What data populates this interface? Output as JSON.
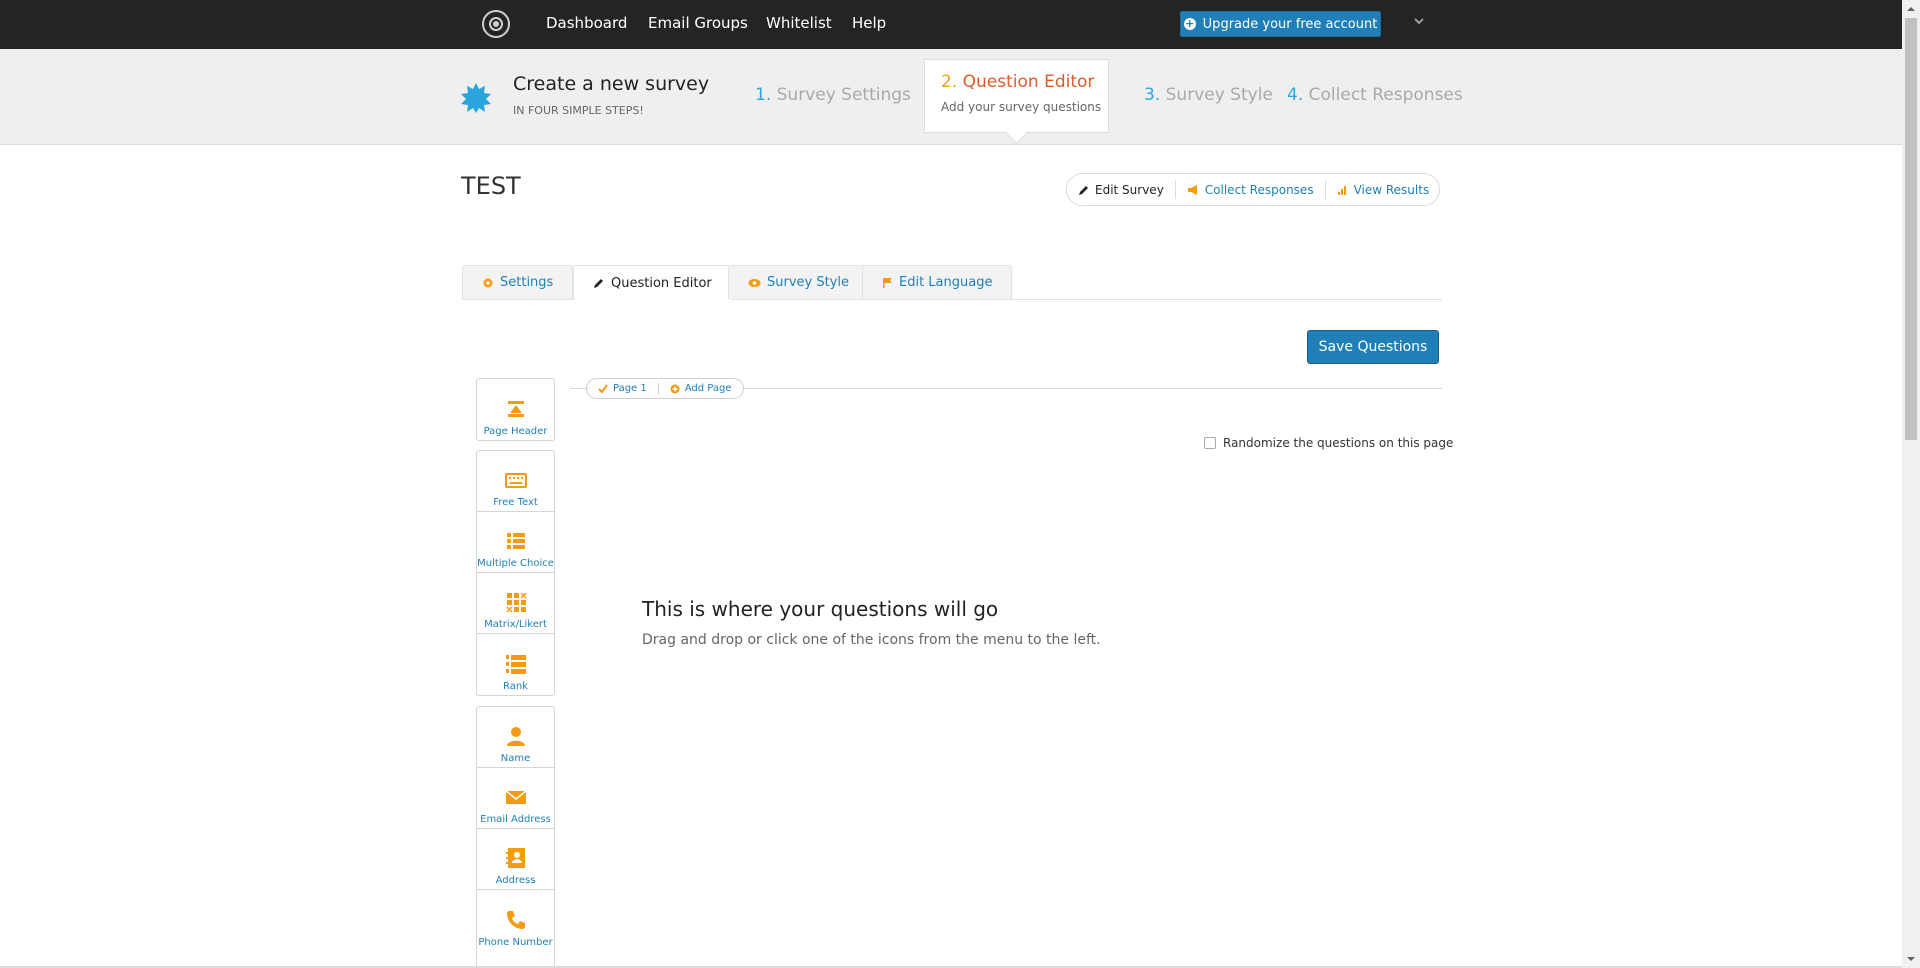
{
  "nav": {
    "links": [
      "Dashboard",
      "Email Groups",
      "Whitelist",
      "Help"
    ],
    "upgrade_label": "Upgrade your free account"
  },
  "steps": {
    "create_title": "Create a new survey",
    "create_sub": "IN FOUR SIMPLE STEPS!",
    "items": [
      {
        "num": "1.",
        "label": "Survey Settings"
      },
      {
        "num": "2.",
        "label": "Question Editor",
        "sub": "Add your survey questions"
      },
      {
        "num": "3.",
        "label": "Survey Style"
      },
      {
        "num": "4.",
        "label": "Collect Responses"
      }
    ]
  },
  "survey": {
    "title": "TEST",
    "actions": [
      "Edit Survey",
      "Collect Responses",
      "View Results"
    ]
  },
  "tabs": [
    "Settings",
    "Question Editor",
    "Survey Style",
    "Edit Language"
  ],
  "save_label": "Save Questions",
  "palette": {
    "group1": [
      "Page Header"
    ],
    "group2": [
      "Free Text",
      "Multiple Choice",
      "Matrix/Likert",
      "Rank"
    ],
    "group3": [
      "Name",
      "Email Address",
      "Address",
      "Phone Number"
    ]
  },
  "pagebar": [
    "Page 1",
    "Add Page"
  ],
  "randomize_label": "Randomize the questions on this page",
  "empty": {
    "title": "This is where your questions will go",
    "sub": "Drag and drop or click one of the icons from the menu to the left."
  },
  "colors": {
    "accent": "#1f7fb6",
    "orange": "#f39c12",
    "active_step": "#e05a2b",
    "topbar": "#242424"
  }
}
